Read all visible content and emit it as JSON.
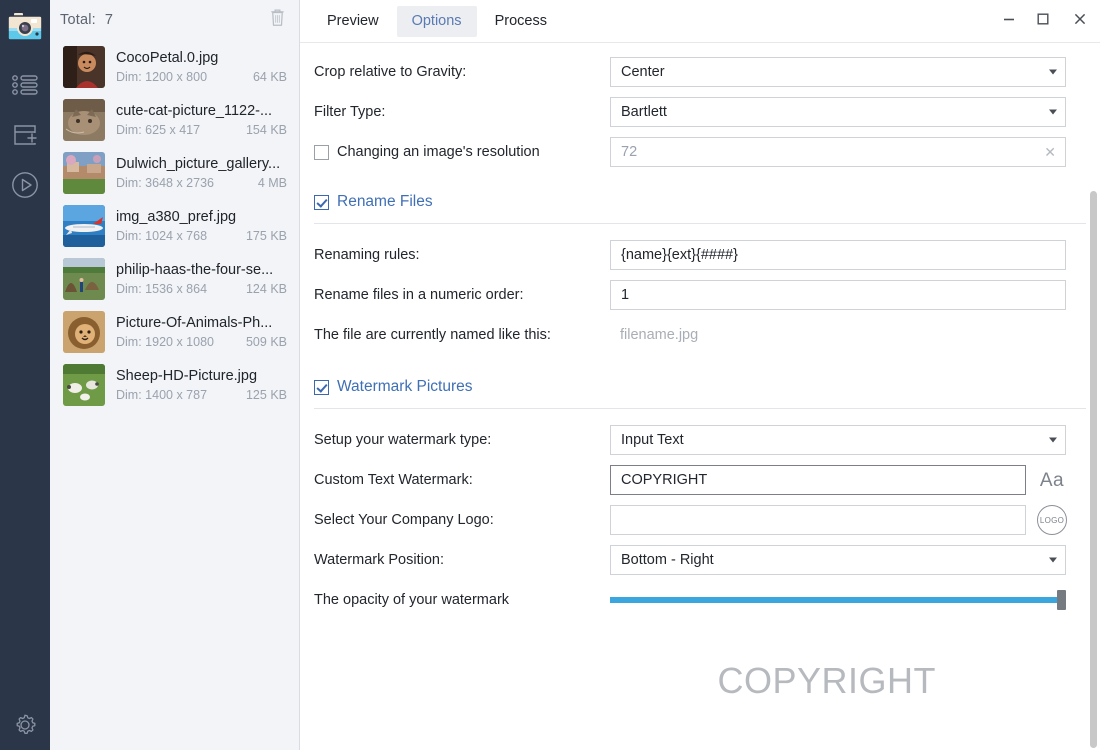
{
  "rail": {
    "logo_icon": "camera-logo-icon",
    "items": [
      {
        "name": "list-icon",
        "label": "List"
      },
      {
        "name": "add-icon",
        "label": "Add"
      },
      {
        "name": "play-icon",
        "label": "Play"
      }
    ],
    "settings": {
      "name": "gear-icon",
      "label": "Settings"
    }
  },
  "filepanel": {
    "total_label": "Total:",
    "total_count": "7",
    "trash_icon": "trash-icon",
    "files": [
      {
        "name": "CocoPetal.0.jpg",
        "dim": "Dim: 1200 x 800",
        "size": "64 KB"
      },
      {
        "name": "cute-cat-picture_1122-...",
        "dim": "Dim: 625 x 417",
        "size": "154 KB"
      },
      {
        "name": "Dulwich_picture_gallery...",
        "dim": "Dim: 3648 x 2736",
        "size": "4 MB"
      },
      {
        "name": "img_a380_pref.jpg",
        "dim": "Dim: 1024 x 768",
        "size": "175 KB"
      },
      {
        "name": "philip-haas-the-four-se...",
        "dim": "Dim: 1536 x 864",
        "size": "124 KB"
      },
      {
        "name": "Picture-Of-Animals-Ph...",
        "dim": "Dim: 1920 x 1080",
        "size": "509 KB"
      },
      {
        "name": "Sheep-HD-Picture.jpg",
        "dim": "Dim: 1400 x 787",
        "size": "125 KB"
      }
    ]
  },
  "titlebar": {
    "tabs": [
      {
        "label": "Preview",
        "active": false
      },
      {
        "label": "Options",
        "active": true
      },
      {
        "label": "Process",
        "active": false
      }
    ],
    "minimize_icon": "minimize-icon",
    "maximize_icon": "maximize-icon",
    "close_icon": "close-icon"
  },
  "options": {
    "crop_gravity": {
      "label": "Crop relative to Gravity:",
      "value": "Center"
    },
    "filter_type": {
      "label": "Filter Type:",
      "value": "Bartlett"
    },
    "resolution": {
      "label": "Changing an image's resolution",
      "value": "72",
      "checked": false,
      "clear_icon": "clear-x-icon"
    }
  },
  "rename": {
    "section_label": "Rename Files",
    "checked": true,
    "rules": {
      "label": "Renaming rules:",
      "value": "{name}{ext}{####}"
    },
    "numeric": {
      "label": "Rename files in a numeric order:",
      "value": "1"
    },
    "current": {
      "label": "The file are currently named like this:",
      "value": "filename.jpg"
    }
  },
  "watermark": {
    "section_label": "Watermark Pictures",
    "checked": true,
    "type": {
      "label": "Setup your watermark type:",
      "value": "Input Text"
    },
    "text": {
      "label": "Custom Text Watermark:",
      "value": "COPYRIGHT",
      "button": "Aa"
    },
    "logo": {
      "label": "Select Your Company Logo:",
      "value": "",
      "button": "LOGO"
    },
    "position": {
      "label": "Watermark Position:",
      "value": "Bottom - Right"
    },
    "opacity": {
      "label": "The opacity of your watermark",
      "percent": 100
    },
    "preview_text": "COPYRIGHT"
  },
  "colors": {
    "rail_bg": "#2b3648",
    "panel_bg": "#f2f4f7",
    "accent_blue": "#3f6fb5",
    "slider_blue": "#3ba6dd",
    "tab_active_bg": "#eceef1"
  }
}
